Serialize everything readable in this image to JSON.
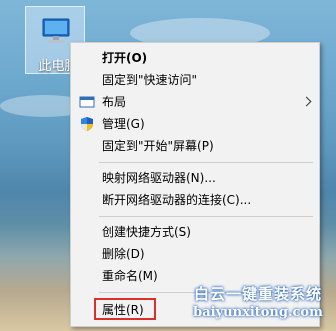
{
  "desktop": {
    "icon_label": "此电脑",
    "icon_name": "computer-icon"
  },
  "context_menu": {
    "items": [
      {
        "label": "打开(O)",
        "bold": true
      },
      {
        "label": "固定到\"快速访问\""
      },
      {
        "label": "布局",
        "icon": "layout-icon",
        "has_submenu": true
      },
      {
        "label": "管理(G)",
        "icon": "uac-shield-icon"
      },
      {
        "label": "固定到\"开始\"屏幕(P)"
      },
      {
        "label": "映射网络驱动器(N)..."
      },
      {
        "label": "断开网络驱动器的连接(C)..."
      },
      {
        "label": "创建快捷方式(S)"
      },
      {
        "label": "删除(D)"
      },
      {
        "label": "重命名(M)"
      },
      {
        "label": "属性(R)",
        "highlighted": true
      }
    ]
  },
  "watermark": {
    "line1": "白云一键重装系统",
    "line2": "baiyunxitong.com"
  },
  "colors": {
    "highlight_border": "#d9302b",
    "menu_bg": "#f2f2f2",
    "watermark_glow": "#2563b8"
  }
}
